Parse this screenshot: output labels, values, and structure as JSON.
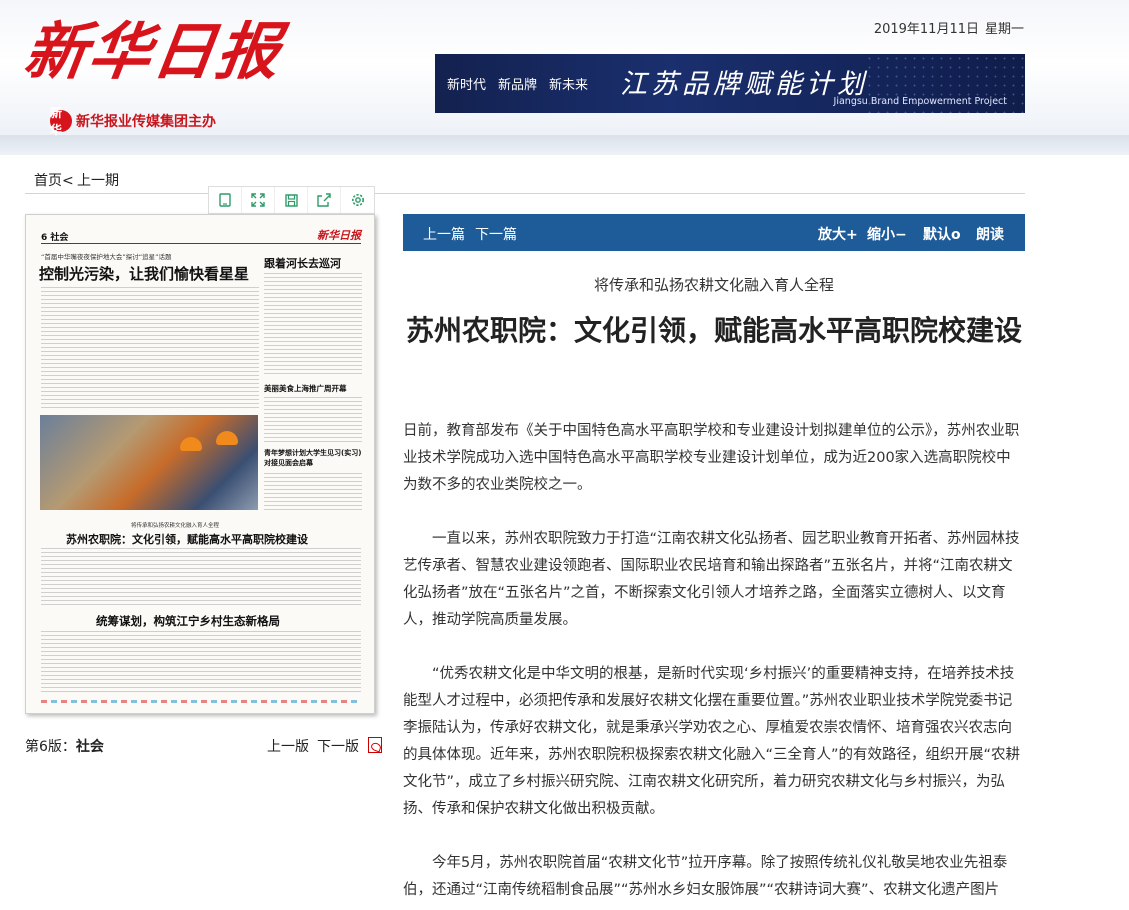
{
  "header": {
    "logo_text": "新华日报",
    "sub_logo_mark": "新华",
    "sub_logo_text": "新华报业传媒集团主办",
    "date": "2019年11月11日",
    "weekday": "星期一",
    "banner": {
      "slogans": [
        "新时代",
        "新品牌",
        "新未来"
      ],
      "title": "江苏品牌赋能计划",
      "subtitle_en": "Jiangsu Brand Empowerment Project"
    }
  },
  "breadcrumb": {
    "home": "首页",
    "separator": "<",
    "prev_issue": "上一期"
  },
  "toolbar": {
    "icons": [
      "copy-icon",
      "fullscreen-icon",
      "save-icon",
      "share-icon",
      "settings-icon"
    ]
  },
  "paper_page": {
    "page_no": "6",
    "section": "社会",
    "masthead": "新华日报",
    "kicker": "“首届中华嘴夜夜保护地大会”探讨“追星”话题",
    "headline_1": "控制光污染，让我们愉快看星星",
    "side_headline": "跟着河长去巡河",
    "side_item_1": "美丽美食上海推广周开幕",
    "side_item_2": "青年梦想计划大学生见习(实习)对接见面会启幕",
    "kicker_2": "将传承和弘扬农耕文化融入育人全程",
    "headline_2": "苏州农职院：文化引领，赋能高水平高职院校建设",
    "headline_3": "统筹谋划，构筑江宁乡村生态新格局"
  },
  "page_info": {
    "label_prefix": "第6版：",
    "section": "社会",
    "prev_page": "上一版",
    "next_page": "下一版"
  },
  "article_bar": {
    "prev_article": "上一篇",
    "next_article": "下一篇",
    "zoom_in": "放大+",
    "zoom_out": "缩小−",
    "default": "默认o",
    "read_aloud": "朗读"
  },
  "article": {
    "subtitle": "将传承和弘扬农耕文化融入育人全程",
    "title": "苏州农职院：文化引领，赋能高水平高职院校建设",
    "paragraphs": [
      "日前，教育部发布《关于中国特色高水平高职学校和专业建设计划拟建单位的公示》，苏州农业职业技术学院成功入选中国特色高水平高职学校专业建设计划单位，成为近200家入选高职院校中为数不多的农业类院校之一。",
      "一直以来，苏州农职院致力于打造“江南农耕文化弘扬者、园艺职业教育开拓者、苏州园林技艺传承者、智慧农业建设领跑者、国际职业农民培育和输出探路者”五张名片，并将“江南农耕文化弘扬者”放在“五张名片”之首，不断探索文化引领人才培养之路，全面落实立德树人、以文育人，推动学院高质量发展。",
      "“优秀农耕文化是中华文明的根基，是新时代实现‘乡村振兴’的重要精神支持，在培养技术技能型人才过程中，必须把传承和发展好农耕文化摆在重要位置。”苏州农业职业技术学院党委书记李振陆认为，传承好农耕文化，就是秉承兴学劝农之心、厚植爱农崇农情怀、培育强农兴农志向的具体体现。近年来，苏州农职院积极探索农耕文化融入“三全育人”的有效路径，组织开展“农耕文化节”，成立了乡村振兴研究院、江南农耕文化研究所，着力研究农耕文化与乡村振兴，为弘扬、传承和保护农耕文化做出积极贡献。",
      "今年5月，苏州农职院首届“农耕文化节”拉开序幕。除了按照传统礼仪礼敬吴地农业先祖泰伯，还通过“江南传统稻制食品展”“苏州水乡妇女服饰展”“农耕诗词大赛”、农耕文化遗产图片"
    ]
  }
}
